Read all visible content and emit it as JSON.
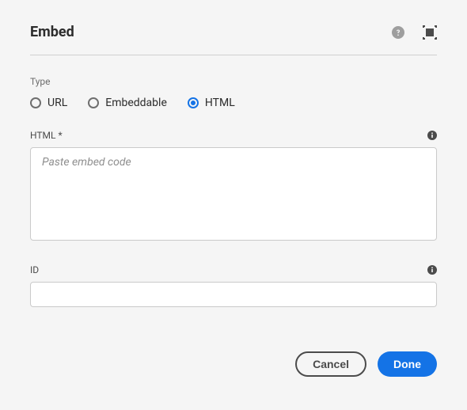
{
  "dialog": {
    "title": "Embed"
  },
  "type": {
    "label": "Type",
    "options": {
      "url": "URL",
      "embeddable": "Embeddable",
      "html": "HTML"
    },
    "selected": "html"
  },
  "htmlField": {
    "label": "HTML *",
    "placeholder": "Paste embed code",
    "value": ""
  },
  "idField": {
    "label": "ID",
    "value": ""
  },
  "buttons": {
    "cancel": "Cancel",
    "done": "Done"
  }
}
